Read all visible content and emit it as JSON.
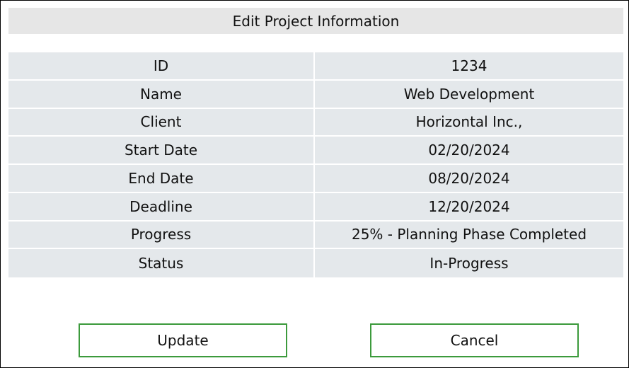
{
  "dialog": {
    "title": "Edit Project Information"
  },
  "fields": [
    {
      "label": "ID",
      "value": "1234"
    },
    {
      "label": "Name",
      "value": "Web Development"
    },
    {
      "label": "Client",
      "value": "Horizontal Inc.,"
    },
    {
      "label": "Start Date",
      "value": "02/20/2024"
    },
    {
      "label": "End Date",
      "value": "08/20/2024"
    },
    {
      "label": "Deadline",
      "value": "12/20/2024"
    },
    {
      "label": "Progress",
      "value": "25% - Planning Phase Completed"
    },
    {
      "label": "Status",
      "value": "In-Progress"
    }
  ],
  "actions": {
    "update_label": "Update",
    "cancel_label": "Cancel"
  },
  "colors": {
    "header_bg": "#e6e6e6",
    "cell_bg": "#e4e8eb",
    "button_border": "#3c9a3c"
  }
}
